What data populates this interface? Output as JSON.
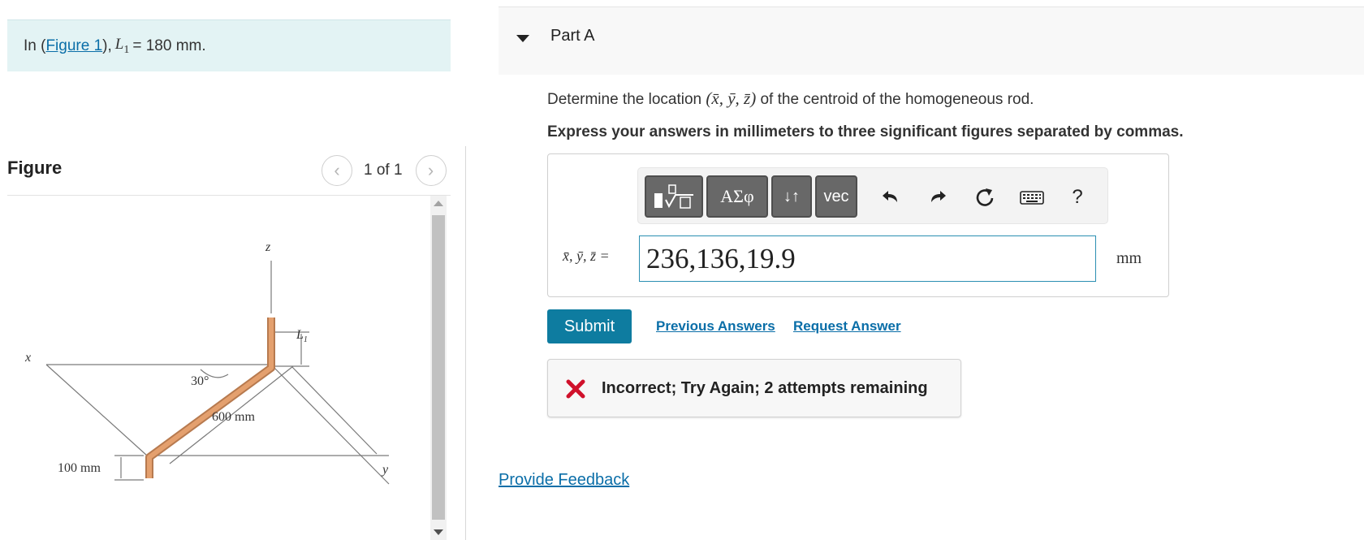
{
  "intro": {
    "prefix": "In (",
    "figure_link": "Figure 1",
    "suffix": "),",
    "variable": "L",
    "subscript": "1",
    "equation": "= 180 mm."
  },
  "figure": {
    "title": "Figure",
    "pager_text": "1 of 1",
    "prev_icon": "chevron-left-icon",
    "next_icon": "chevron-right-icon",
    "labels": {
      "z_axis": "z",
      "x_axis": "x",
      "y_axis": "y",
      "L1": "L",
      "L1_sub": "1",
      "angle": "30°",
      "length_600": "600 mm",
      "length_100": "100 mm"
    },
    "rod_color": "#e4a06e"
  },
  "part": {
    "title": "Part A",
    "question_prefix": "Determine the location",
    "question_vars": "(x̄, ȳ, z̄)",
    "question_suffix": "of the centroid of the homogeneous rod.",
    "instruction": "Express your answers in millimeters to three significant figures separated by commas."
  },
  "toolbar": {
    "templates_icon": "template-sqrt-icon",
    "greek_label": "ΑΣφ",
    "arrows_label": "↓↑",
    "vec_label": "vec",
    "undo_icon": "undo-icon",
    "redo_icon": "redo-icon",
    "reset_icon": "reset-icon",
    "keyboard_icon": "keyboard-icon",
    "help_label": "?"
  },
  "answer": {
    "label": "x̄, ȳ, z̄ =",
    "value": "236,136,19.9",
    "unit": "mm"
  },
  "actions": {
    "submit": "Submit",
    "previous_answers": "Previous Answers",
    "request_answer": "Request Answer"
  },
  "feedback": {
    "message": "Incorrect; Try Again; 2 attempts remaining",
    "status_color": "#d0112b"
  },
  "footer": {
    "provide_feedback": "Provide Feedback"
  },
  "colors": {
    "accent": "#0e7ca0",
    "link": "#0a6ea8",
    "intro_bg": "#e3f3f4"
  }
}
